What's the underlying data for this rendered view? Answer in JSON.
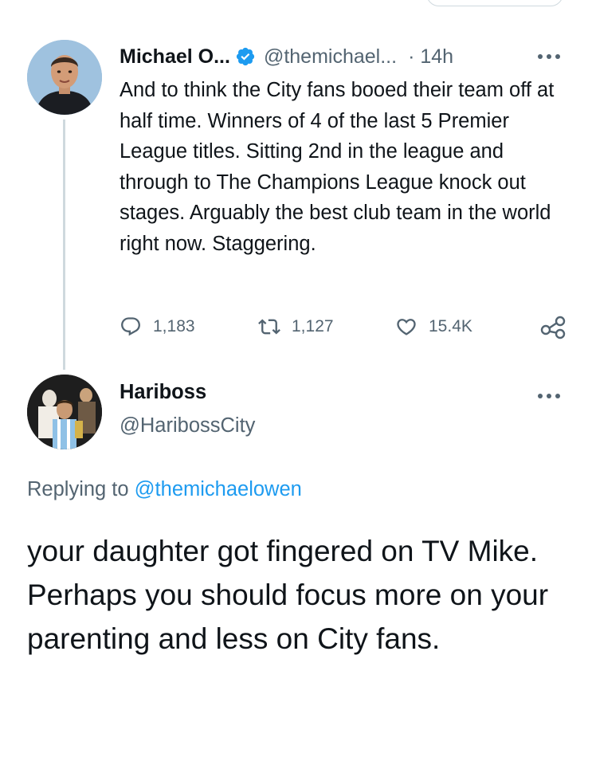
{
  "tweet1": {
    "display_name": "Michael O...",
    "handle": "@themichael...",
    "time": "· 14h",
    "text": "And to think the City fans booed their team off at half time. Winners of 4 of the last 5 Premier League titles. Sitting 2nd in the league and through to The Champions League knock out stages. Arguably the best club team in the world right now. Staggering.",
    "replies": "1,183",
    "retweets": "1,127",
    "likes": "15.4K",
    "icons": [
      "verified-badge-icon",
      "more-options-icon",
      "reply-icon",
      "retweet-icon",
      "like-icon",
      "share-icon"
    ]
  },
  "tweet2": {
    "display_name": "Hariboss",
    "handle": "@HaribossCity",
    "replying_prefix": "Replying to",
    "replying_to": "@themichaelowen",
    "text_paragraph_1": "your daughter got fingered on TV Mike.",
    "text_paragraph_2": "Perhaps you should focus more on your parenting and less on City fans.",
    "icons": [
      "more-options-icon"
    ]
  },
  "colors": {
    "text_primary": "#0f1419",
    "text_secondary": "#536471",
    "accent_blue": "#1d9bf0",
    "border": "#cfd9de"
  }
}
